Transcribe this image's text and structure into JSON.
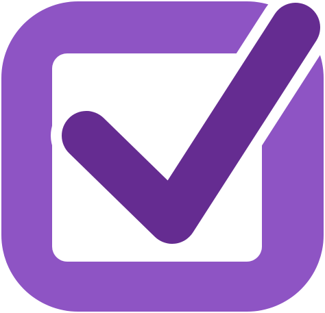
{
  "icon": {
    "name": "checkbox-checked-icon",
    "colors": {
      "frame": "#8e54c4",
      "inner": "#ffffff",
      "check": "#652c91",
      "gap": "#ffffff"
    }
  }
}
